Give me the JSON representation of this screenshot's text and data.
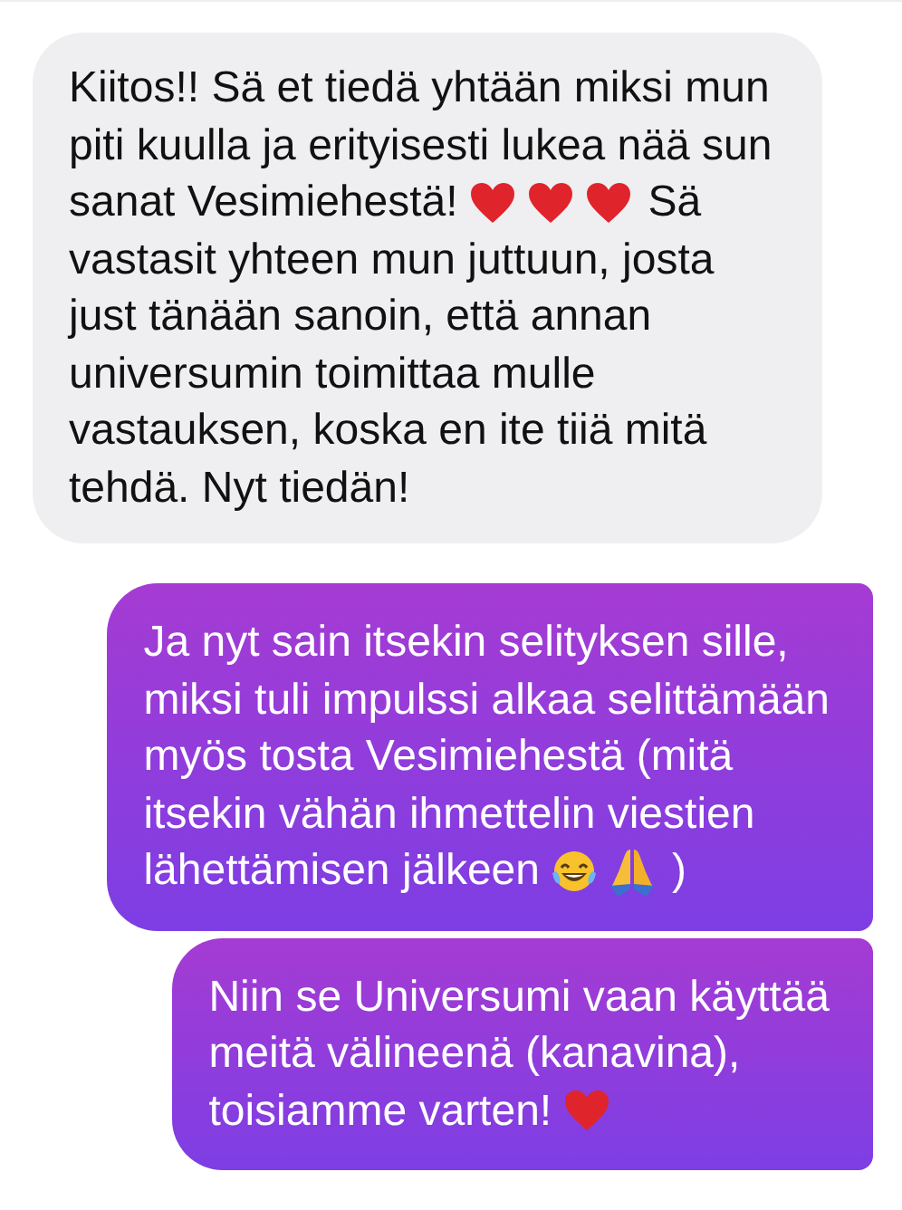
{
  "messages": [
    {
      "kind": "received",
      "lines": [
        [
          {
            "kind": "text",
            "text": "Kiitos!! Sä et tiedä yhtään miksi mun"
          }
        ],
        [
          {
            "kind": "text",
            "text": "piti kuulla ja erityisesti lukea nää sun"
          }
        ],
        [
          {
            "kind": "text",
            "text": "sanat Vesimiehestä!"
          },
          {
            "kind": "heart"
          },
          {
            "kind": "heart"
          },
          {
            "kind": "heart"
          },
          {
            "kind": "text",
            "text": "Sä"
          }
        ],
        [
          {
            "kind": "text",
            "text": "vastasit yhteen mun juttuun, josta"
          }
        ],
        [
          {
            "kind": "text",
            "text": "just tänään sanoin, että annan"
          }
        ],
        [
          {
            "kind": "text",
            "text": "universumin toimittaa mulle"
          }
        ],
        [
          {
            "kind": "text",
            "text": "vastauksen, koska en ite tiiä mitä"
          }
        ],
        [
          {
            "kind": "text",
            "text": "tehdä. Nyt tiedän!"
          }
        ]
      ]
    },
    {
      "kind": "sent",
      "lines": [
        [
          {
            "kind": "text",
            "text": "Ja nyt sain itsekin selityksen sille,"
          }
        ],
        [
          {
            "kind": "text",
            "text": "miksi tuli impulssi alkaa selittämään"
          }
        ],
        [
          {
            "kind": "text",
            "text": "myös tosta Vesimiehestä (mitä"
          }
        ],
        [
          {
            "kind": "text",
            "text": "itsekin vähän ihmettelin viestien"
          }
        ],
        [
          {
            "kind": "text",
            "text": "lähettämisen jälkeen"
          },
          {
            "kind": "laugh"
          },
          {
            "kind": "pray"
          },
          {
            "kind": "text",
            "text": ")"
          }
        ]
      ]
    },
    {
      "kind": "sent",
      "lines": [
        [
          {
            "kind": "text",
            "text": "Niin se Universumi vaan käyttää"
          }
        ],
        [
          {
            "kind": "text",
            "text": "meitä välineenä (kanavina),"
          }
        ],
        [
          {
            "kind": "text",
            "text": "toisiamme varten!"
          },
          {
            "kind": "heart"
          }
        ]
      ]
    }
  ]
}
